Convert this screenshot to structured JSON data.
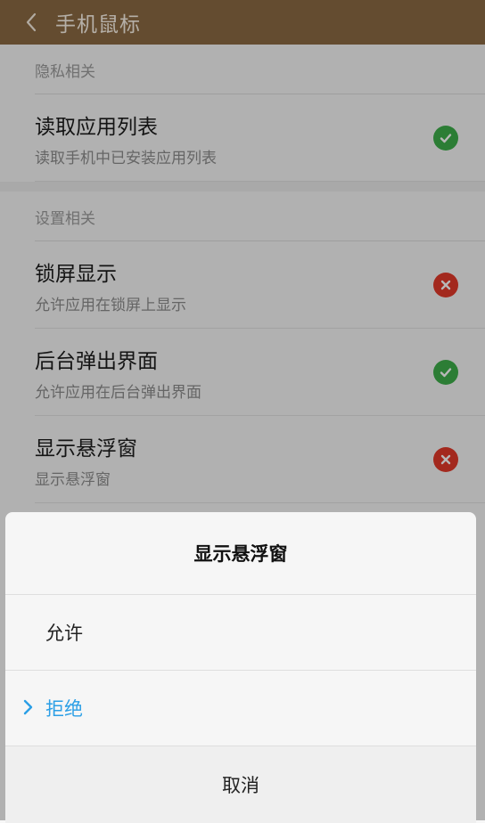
{
  "header": {
    "title": "手机鼠标"
  },
  "sections": [
    {
      "label": "隐私相关",
      "items": [
        {
          "title": "读取应用列表",
          "desc": "读取手机中已安装应用列表",
          "status": "allowed"
        }
      ]
    },
    {
      "label": "设置相关",
      "items": [
        {
          "title": "锁屏显示",
          "desc": "允许应用在锁屏上显示",
          "status": "denied"
        },
        {
          "title": "后台弹出界面",
          "desc": "允许应用在后台弹出界面",
          "status": "allowed"
        },
        {
          "title": "显示悬浮窗",
          "desc": "显示悬浮窗",
          "status": "denied"
        }
      ]
    }
  ],
  "dialog": {
    "title": "显示悬浮窗",
    "options": [
      {
        "label": "允许",
        "selected": false
      },
      {
        "label": "拒绝",
        "selected": true
      }
    ],
    "cancel": "取消"
  },
  "colors": {
    "header_bg": "#8b6a43",
    "allowed": "#3dae4a",
    "denied": "#e23a2a",
    "selected": "#2b9fe6"
  },
  "icons": {
    "back": "chevron-left-icon",
    "allowed": "check-circle-icon",
    "denied": "x-circle-icon",
    "selected": "chevron-right-icon"
  }
}
